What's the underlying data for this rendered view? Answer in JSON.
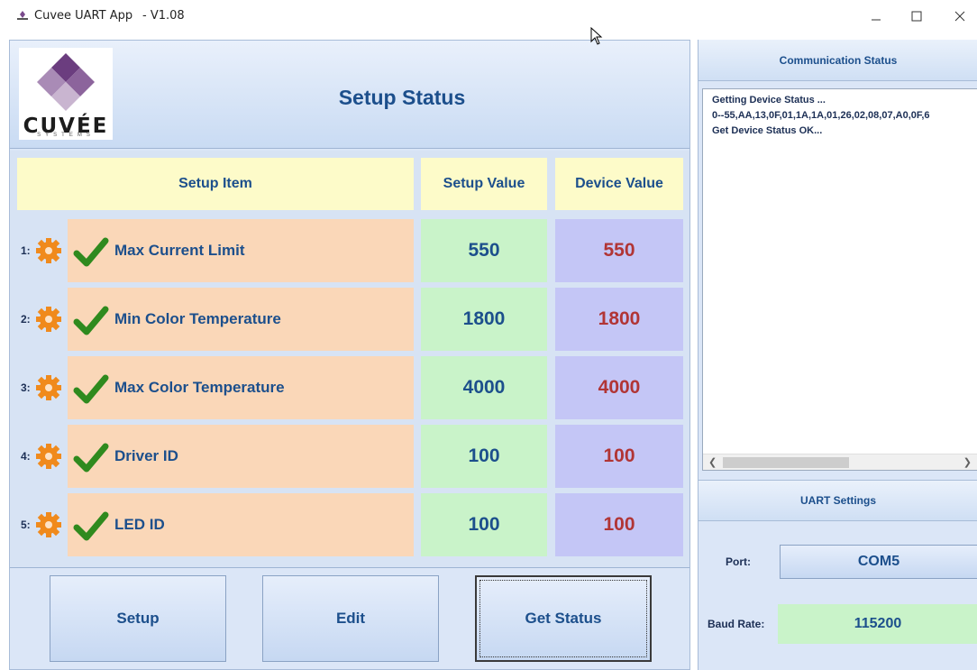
{
  "window": {
    "title": "Cuvee UART App",
    "version": "- V1.08",
    "minimize_icon": "minimize-icon",
    "maximize_icon": "maximize-icon",
    "close_icon": "close-icon"
  },
  "header": {
    "logo_brand": "CUVÉE",
    "logo_sub": "SYSTEMS",
    "page_title": "Setup Status"
  },
  "table": {
    "columns": [
      "Setup Item",
      "Setup Value",
      "Device Value"
    ],
    "rows": [
      {
        "index": "1:",
        "label": "Max Current Limit",
        "setup_value": "550",
        "device_value": "550"
      },
      {
        "index": "2:",
        "label": "Min Color Temperature",
        "setup_value": "1800",
        "device_value": "1800"
      },
      {
        "index": "3:",
        "label": "Max Color Temperature",
        "setup_value": "4000",
        "device_value": "4000"
      },
      {
        "index": "4:",
        "label": "Driver ID",
        "setup_value": "100",
        "device_value": "100"
      },
      {
        "index": "5:",
        "label": "LED ID",
        "setup_value": "100",
        "device_value": "100"
      }
    ]
  },
  "buttons": {
    "setup": "Setup",
    "edit": "Edit",
    "get_status": "Get Status"
  },
  "communication": {
    "title": "Communication Status",
    "log": [
      "Getting Device Status ...",
      "0--55,AA,13,0F,01,1A,1A,01,26,02,08,07,A0,0F,6",
      "Get Device Status OK..."
    ]
  },
  "uart": {
    "title": "UART Settings",
    "port_label": "Port:",
    "port_value": "COM5",
    "baud_label": "Baud Rate:",
    "baud_value": "115200"
  },
  "colors": {
    "accent_text": "#1c4f8c",
    "device_value_text": "#b13535",
    "setup_item_bg": "#fad7b8",
    "setup_value_bg": "#c9f3c9",
    "device_value_bg": "#c4c6f6",
    "header_row_bg": "#fdfbc9",
    "check_green": "#2f8a1e",
    "gear_orange": "#f08a1c"
  }
}
